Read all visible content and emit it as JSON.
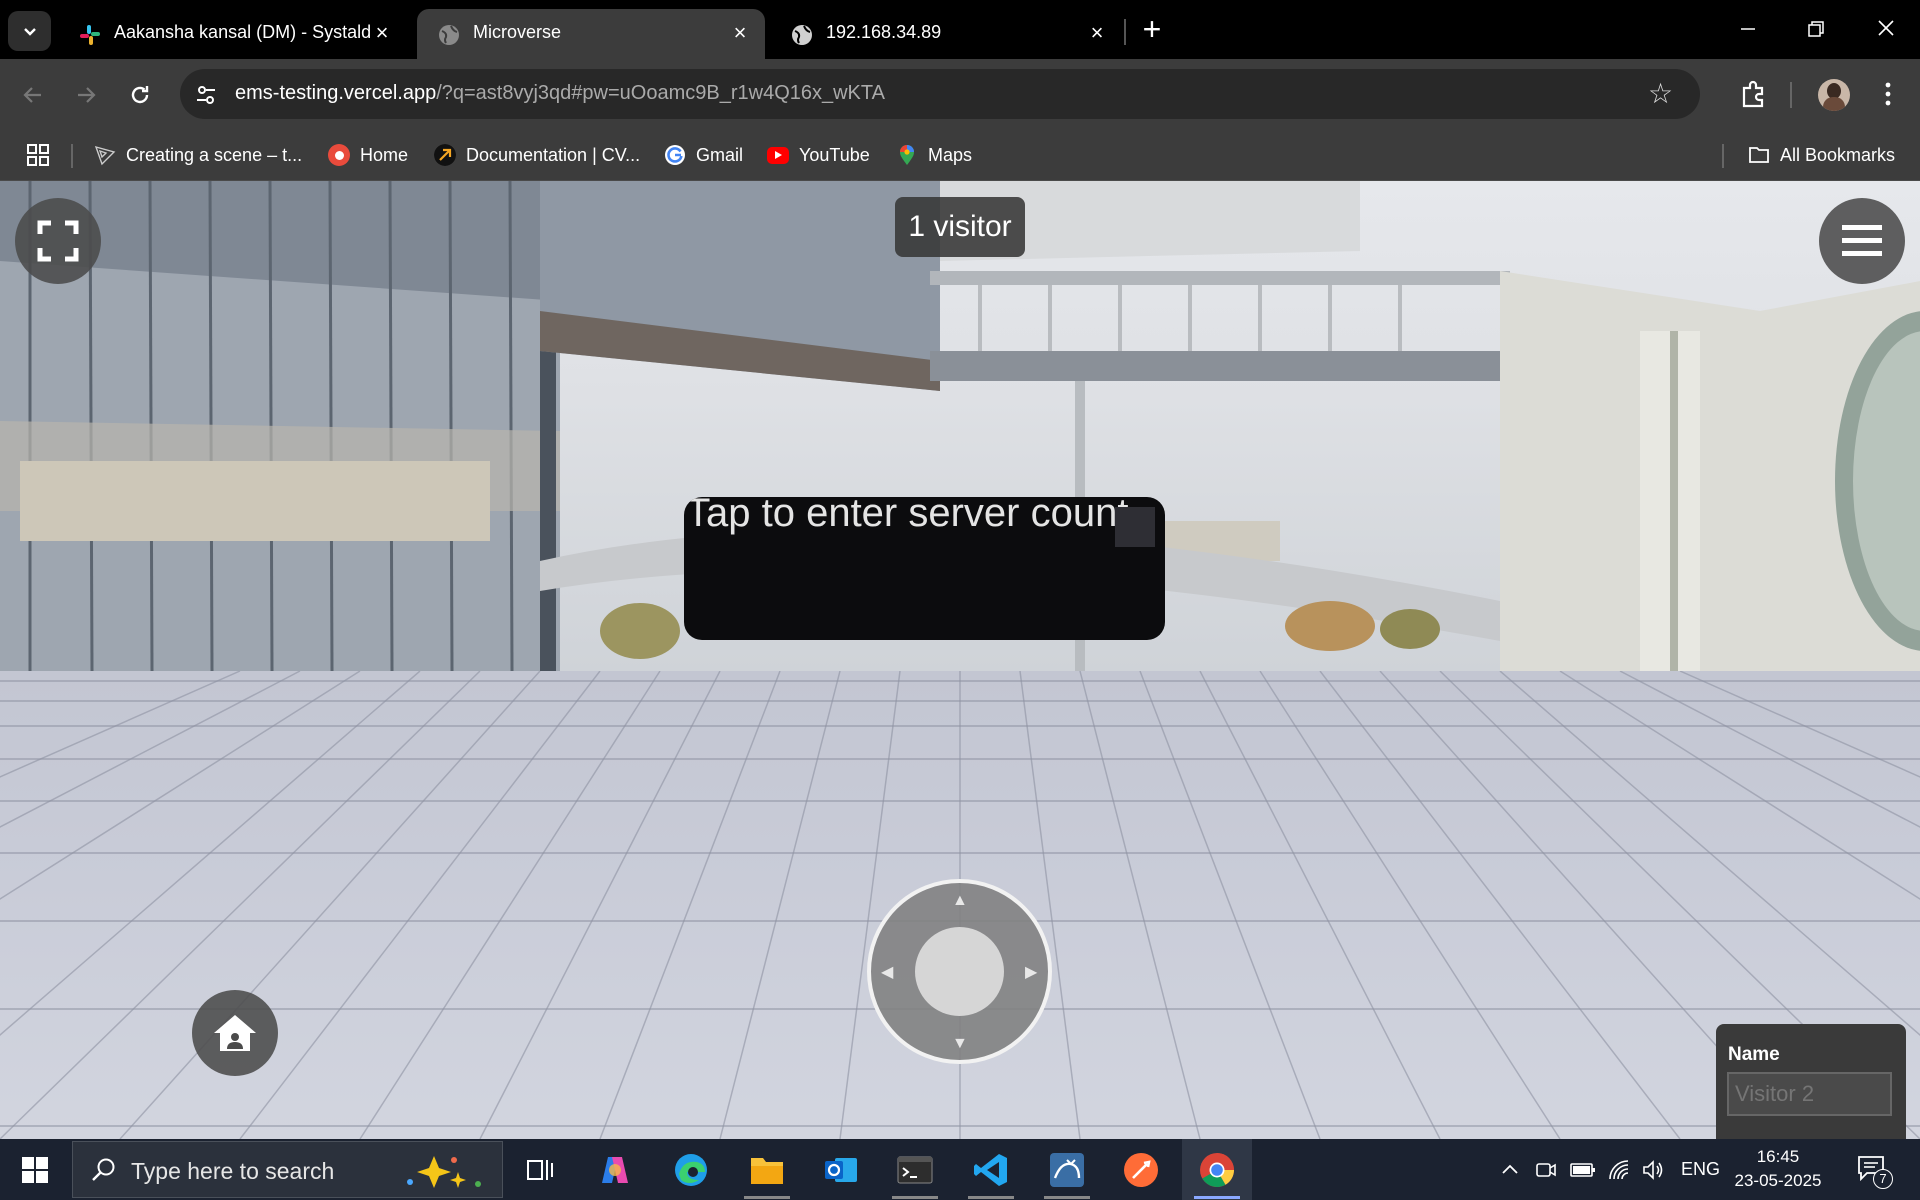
{
  "browser": {
    "tabs": [
      {
        "title": "Aakansha kansal (DM) - Systald",
        "active": false,
        "icon": "slack-icon"
      },
      {
        "title": "Microverse",
        "active": true,
        "icon": "globe-icon"
      },
      {
        "title": "192.168.34.89",
        "active": false,
        "icon": "globe-icon"
      }
    ],
    "address": {
      "domain": "ems-testing.vercel.app",
      "path": "/?q=ast8vyj3qd#pw=uOoamc9B_r1w4Q16x_wKTA"
    },
    "bookmarks": [
      {
        "label": "Creating a scene – t...",
        "icon": "threejs-icon"
      },
      {
        "label": "Home",
        "icon": "home-bookmark-icon",
        "color": "#e94b3c"
      },
      {
        "label": "Documentation | CV...",
        "icon": "cvat-icon"
      },
      {
        "label": "Gmail",
        "icon": "google-icon"
      },
      {
        "label": "YouTube",
        "icon": "youtube-icon",
        "color": "#ff0000"
      },
      {
        "label": "Maps",
        "icon": "maps-icon"
      }
    ],
    "all_bookmarks": "All Bookmarks"
  },
  "scene": {
    "visitor_count": "1 visitor",
    "server_prompt": "Tap to enter server count",
    "name_label": "Name",
    "name_placeholder": "Visitor 2"
  },
  "taskbar": {
    "search_placeholder": "Type here to search",
    "language": "ENG",
    "time": "16:45",
    "date": "23-05-2025",
    "notifications": "7"
  }
}
